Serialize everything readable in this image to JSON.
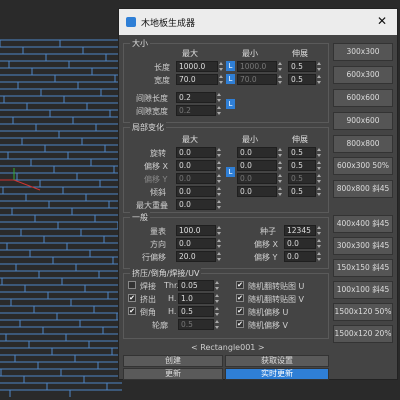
{
  "window": {
    "title": "木地板生成器",
    "close": "✕"
  },
  "size": {
    "legend": "大小",
    "col_max": "最大",
    "col_min": "最小",
    "col_stretch": "伸展",
    "rows": [
      {
        "label": "长度",
        "max": "1000.0",
        "min": "1000.0",
        "stretch": "0.5"
      },
      {
        "label": "宽度",
        "max": "70.0",
        "min": "70.0",
        "stretch": "0.5"
      }
    ],
    "gap_length": {
      "label": "间隙长度",
      "value": "0.2"
    },
    "gap_width": {
      "label": "间隙宽度",
      "value": "0.2"
    },
    "lock": "L"
  },
  "local": {
    "legend": "局部变化",
    "col_max": "最大",
    "col_min": "最小",
    "col_stretch": "伸展",
    "rows": [
      {
        "label": "旋转",
        "max": "0.0",
        "min": "0.0",
        "stretch": "0.5"
      },
      {
        "label": "偏移 X",
        "max": "0.0",
        "min": "0.0",
        "stretch": "0.5"
      },
      {
        "label": "偏移 Y",
        "max": "0.0",
        "min": "0.0",
        "stretch": "0.5"
      },
      {
        "label": "倾斜",
        "max": "0.0",
        "min": "0.0",
        "stretch": "0.5"
      }
    ],
    "max_overlap": {
      "label": "最大重叠",
      "value": "0.0"
    },
    "lock": "L"
  },
  "general": {
    "legend": "一般",
    "quantity": {
      "label": "量表",
      "value": "100.0"
    },
    "direction": {
      "label": "方向",
      "value": "0.0"
    },
    "row_offset": {
      "label": "行偏移",
      "value": "20.0"
    },
    "seed": {
      "label": "种子",
      "value": "12345"
    },
    "offset_x": {
      "label": "偏移 X",
      "value": "0.0"
    },
    "offset_y": {
      "label": "偏移 Y",
      "value": "0.0"
    }
  },
  "extrude": {
    "legend": "挤压/倒角/焊接/UV",
    "weld": {
      "label": "焊接",
      "sub": "Thr.",
      "value": "0.05",
      "checked": false
    },
    "extrude": {
      "label": "挤出",
      "sub": "H.",
      "value": "1.0",
      "checked": true
    },
    "bevel": {
      "label": "倒角",
      "sub": "H.",
      "value": "0.5",
      "checked": true
    },
    "outline": {
      "label": "轮廓",
      "value": "0.5"
    },
    "random_flip_u": {
      "label": "随机翻转贴图 U",
      "checked": true
    },
    "random_flip_v": {
      "label": "随机翻转贴图 V",
      "checked": true
    },
    "random_offset_u": {
      "label": "随机偏移 U",
      "checked": true
    },
    "random_offset_v": {
      "label": "随机偏移 V",
      "checked": true
    }
  },
  "object_name": "< Rectangle001 >",
  "buttons": {
    "create": "创建",
    "get_settings": "获取设置",
    "update": "更新",
    "realtime_update": "实时更新"
  },
  "presets": [
    "300x300",
    "600x300",
    "600x600",
    "900x600",
    "800x800",
    "600x300 50%",
    "800x800 斜45",
    "400x400 斜45",
    "300x300 斜45",
    "150x150 斜45",
    "100x100 斜45",
    "1500x120 50%",
    "1500x120 20%"
  ]
}
